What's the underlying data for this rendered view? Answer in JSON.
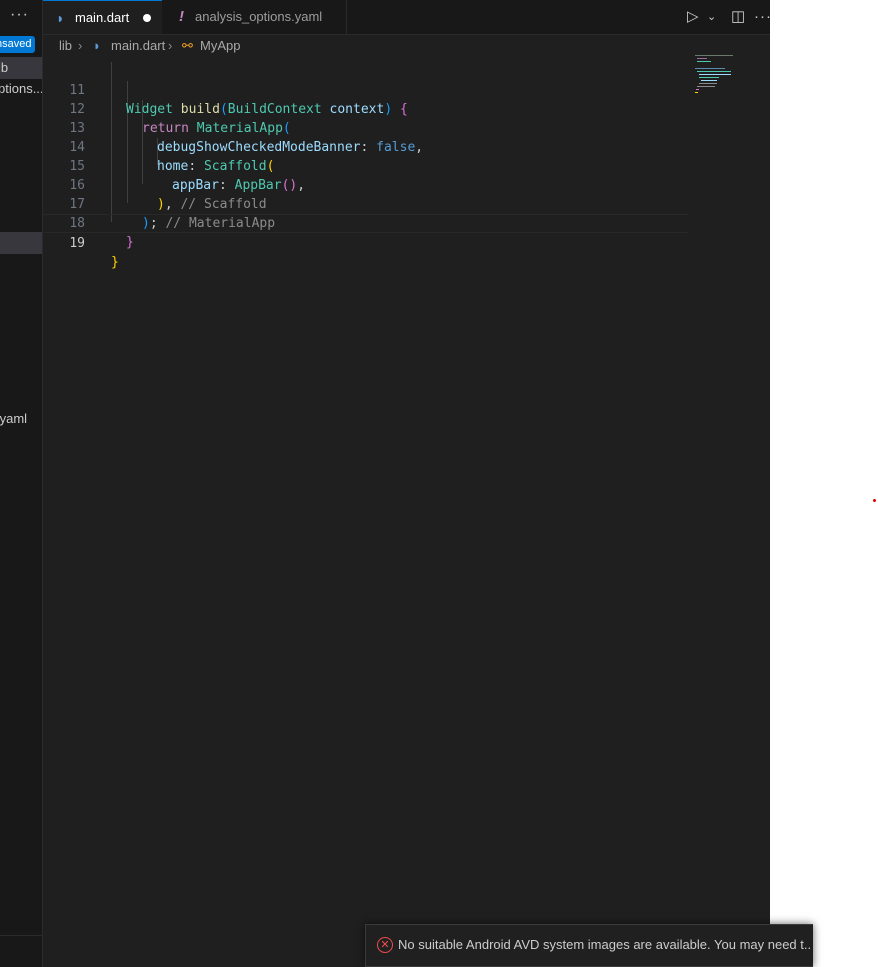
{
  "sidebar": {
    "more": "···",
    "unsaved_badge": "nsaved",
    "items": [
      {
        "label": "ib"
      },
      {
        "label": "ptions..."
      },
      {
        "label": ".yaml"
      }
    ]
  },
  "tabs": [
    {
      "label": "main.dart",
      "icon": "dart-icon",
      "modified": true
    },
    {
      "label": "analysis_options.yaml",
      "icon": "warning-exclamation-icon"
    }
  ],
  "editor_actions": {
    "run": "▷",
    "chevron": "⌄",
    "split": "◫",
    "more": "···"
  },
  "breadcrumb": {
    "folder": "lib",
    "sep": "›",
    "file": "main.dart",
    "symbol": "MyApp"
  },
  "code": {
    "lines": [
      {
        "n": "11"
      },
      {
        "n": "12"
      },
      {
        "n": "13"
      },
      {
        "n": "14"
      },
      {
        "n": "15"
      },
      {
        "n": "16"
      },
      {
        "n": "17"
      },
      {
        "n": "18"
      },
      {
        "n": "19"
      }
    ],
    "tokens": {
      "widget": "Widget",
      "build": "build",
      "ctxType": "BuildContext",
      "ctx": "context",
      "ret": "return",
      "material": "MaterialApp",
      "debug": "debugShowCheckedModeBanner",
      "false": "false",
      "home": "home",
      "scaffold": "Scaffold",
      "appBarProp": "appBar",
      "appBar": "AppBar",
      "cScaffold": "// Scaffold",
      "cMaterial": "// MaterialApp"
    }
  },
  "notification": {
    "message": "No suitable Android AVD system images are available. You may need t..."
  },
  "colors": {
    "accent": "#0078d4",
    "error": "#f14c4c",
    "editor_bg": "#1f1f1f"
  }
}
